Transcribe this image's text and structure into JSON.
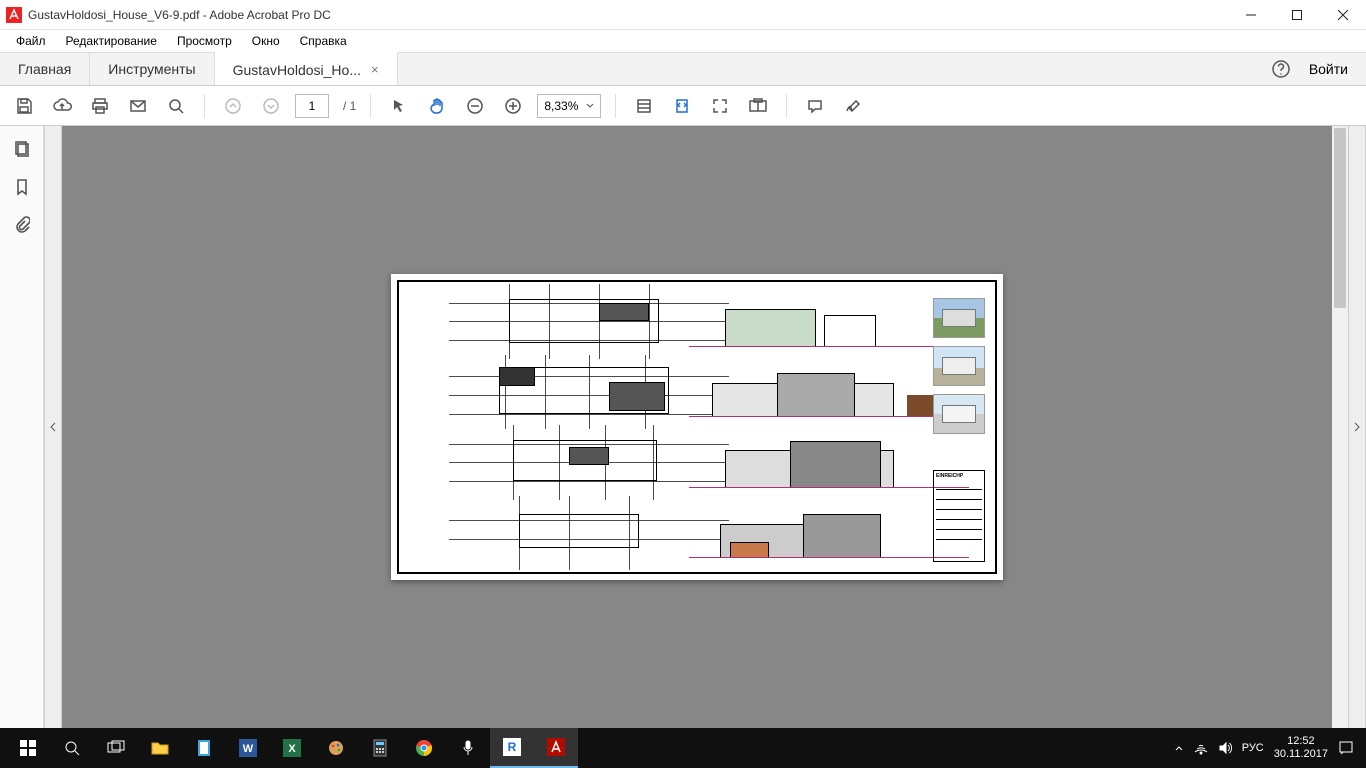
{
  "window": {
    "title": "GustavHoldosi_House_V6-9.pdf - Adobe Acrobat Pro DC"
  },
  "menu": {
    "file": "Файл",
    "edit": "Редактирование",
    "view": "Просмотр",
    "window": "Окно",
    "help": "Справка"
  },
  "tabs": {
    "home": "Главная",
    "tools": "Инструменты",
    "doc": "GustavHoldosi_Ho...",
    "login": "Войти"
  },
  "toolbar": {
    "page_current": "1",
    "page_total": "/  1",
    "zoom": "8,33%"
  },
  "document": {
    "titleblock_header": "EINREICHP"
  },
  "tray": {
    "lang": "РУС",
    "time": "12:52",
    "date": "30.11.2017"
  }
}
